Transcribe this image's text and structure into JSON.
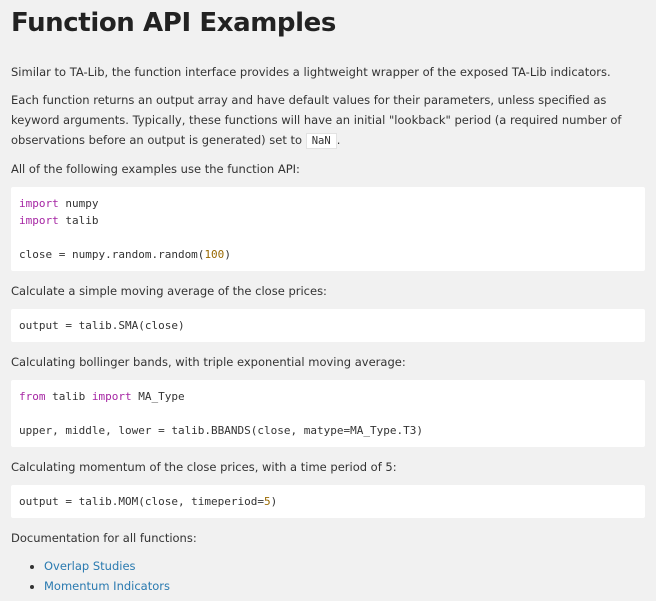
{
  "title": "Function API Examples",
  "intro": "Similar to TA-Lib, the function interface provides a lightweight wrapper of the exposed TA-Lib indicators.",
  "desc_part1": "Each function returns an output array and have default values for their parameters, unless specified as keyword arguments. Typically, these functions will have an initial \"lookback\" period (a required number of observations before an output is generated) set to",
  "desc_code": "NaN",
  "desc_part2": ".",
  "examples_intro": "All of the following examples use the function API:",
  "code1": {
    "l1_kw": "import",
    "l1_rest": " numpy",
    "l2_kw": "import",
    "l2_rest": " talib",
    "l3_pre": "close = numpy.random.random(",
    "l3_num": "100",
    "l3_post": ")"
  },
  "sma_label": "Calculate a simple moving average of the close prices:",
  "code2": "output = talib.SMA(close)",
  "bbands_label": "Calculating bollinger bands, with triple exponential moving average:",
  "code3": {
    "l1_kw1": "from",
    "l1_mid": " talib ",
    "l1_kw2": "import",
    "l1_rest": " MA_Type",
    "l2": "upper, middle, lower = talib.BBANDS(close, matype=MA_Type.T3)"
  },
  "mom_label": "Calculating momentum of the close prices, with a time period of 5:",
  "code4": {
    "pre": "output = talib.MOM(close, timeperiod=",
    "num": "5",
    "post": ")"
  },
  "docs_label": "Documentation for all functions:",
  "links": [
    "Overlap Studies",
    "Momentum Indicators"
  ]
}
